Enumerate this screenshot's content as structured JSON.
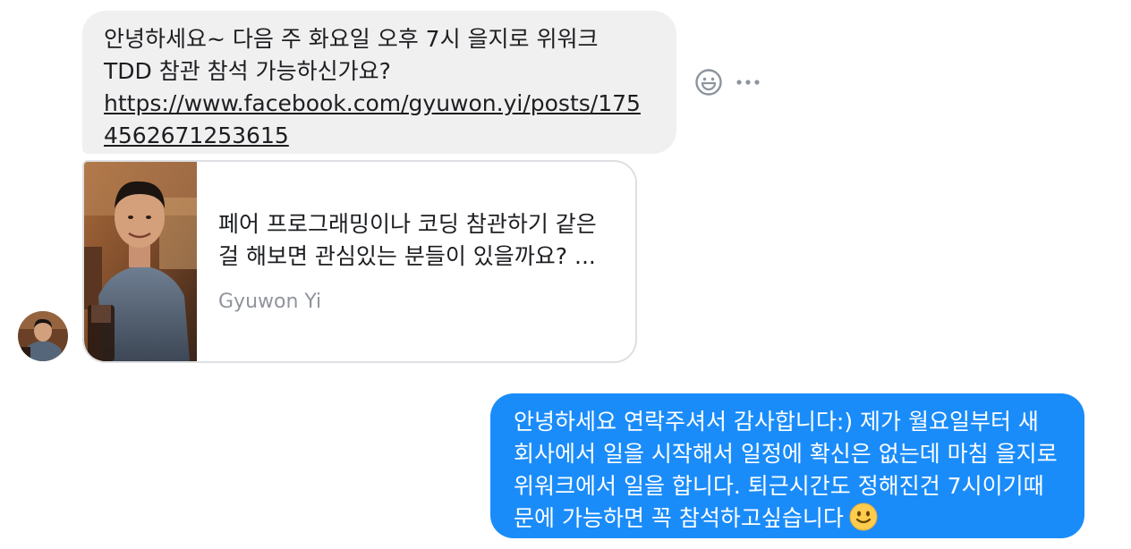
{
  "incoming_message": {
    "text_line_1": "안녕하세요~ 다음 주 화요일 오후 7시 을지로 위워크",
    "text_line_2": "TDD 참관 참석 가능하신가요?",
    "link": "https://www.facebook.com/gyuwon.yi/posts/1754562671253615"
  },
  "link_preview": {
    "title": "페어 프로그래밍이나 코딩 참관하기 같은 걸 해보면 관심있는 분들이 있을까요? ...",
    "source": "Gyuwon Yi"
  },
  "message_actions": {
    "react_icon": "smiley-react-icon",
    "more_icon": "more-dots-icon"
  },
  "outgoing_message": {
    "text": "안녕하세요 연락주셔서 감사합니다:) 제가 월요일부터 새 회사에서 일을 시작해서 일정에 확신은 없는데 마침 을지로 위워크에서 일을 합니다. 퇴근시간도 정해진건 7시이기때문에 가능하면 꼭 참석하고싶습니다",
    "emoji": "slightly-smiling-face"
  },
  "colors": {
    "incoming_bubble": "#f1f0f0",
    "outgoing_bubble": "#1a8cfa",
    "card_border": "#dddfe2",
    "secondary_text": "#90949c"
  }
}
